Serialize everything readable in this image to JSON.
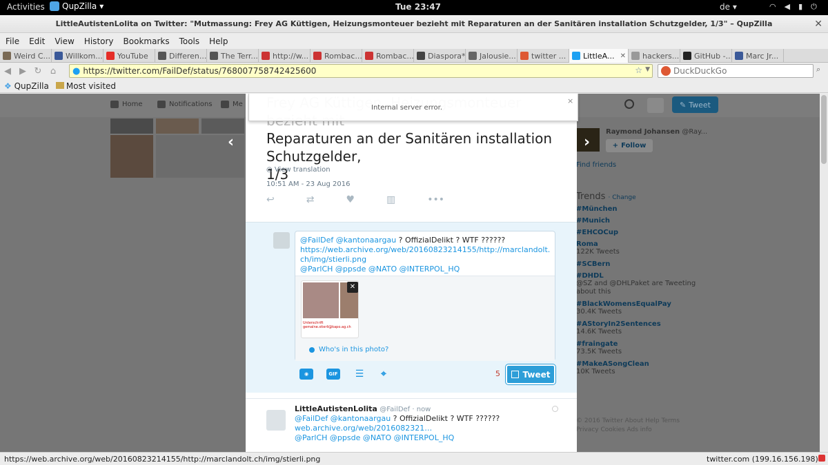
{
  "topbar": {
    "activities": "Activities",
    "app": "QupZilla",
    "clock": "Tue 23:47",
    "lang": "de"
  },
  "window": {
    "title": "LittleAutistenLolita on Twitter: \"Mutmassung: Frey AG Küttigen, Heizungsmonteuer bezieht mit Reparaturen an der Sanitären installation Schutzgelder, 1/3\" – QupZilla"
  },
  "menu": [
    "File",
    "Edit",
    "View",
    "History",
    "Bookmarks",
    "Tools",
    "Help"
  ],
  "tabs": [
    {
      "label": "Weird C...",
      "color": "#7a6a55"
    },
    {
      "label": "Willkom...",
      "color": "#3b5998"
    },
    {
      "label": "YouTube",
      "color": "#e52d27"
    },
    {
      "label": "Differen...",
      "color": "#555555"
    },
    {
      "label": "The Terr...",
      "color": "#555555"
    },
    {
      "label": "http://w...",
      "color": "#cc3333"
    },
    {
      "label": "Rombac...",
      "color": "#cc3333"
    },
    {
      "label": "Rombac...",
      "color": "#cc3333"
    },
    {
      "label": "Diaspora*",
      "color": "#444444"
    },
    {
      "label": "Jalousie...",
      "color": "#666666"
    },
    {
      "label": "twitter ...",
      "color": "#de5833"
    },
    {
      "label": "LittleA...",
      "color": "#1da1f2",
      "active": true
    },
    {
      "label": "hackers...",
      "color": "#999999"
    },
    {
      "label": "GitHub -...",
      "color": "#222222"
    },
    {
      "label": "Marc Jr...",
      "color": "#3b5998"
    }
  ],
  "nav": {
    "url": "https://twitter.com/FailDef/status/768007758742425600",
    "search_placeholder": "DuckDuckGo"
  },
  "bookmarks": {
    "qupzilla": "QupZilla",
    "most_visited": "Most visited"
  },
  "twitter_nav": {
    "home": "Home",
    "notifications": "Notifications",
    "messages": "Me",
    "tweet": "Tweet"
  },
  "error": {
    "message": "Internal server error.",
    "close": "×"
  },
  "tweet": {
    "ghost_line": "Frey AG Küttigen, Heizungsmonteuer bezieht mit",
    "line2": "Reparaturen an der Sanitären installation",
    "line3": "Schutzgelder,",
    "line4": "1/3",
    "translate": "View translation",
    "timestamp": "10:51 AM - 23 Aug 2016"
  },
  "composer": {
    "line1_mentions": "@FailDef @kantonaargau",
    "line1_text": " ? OffizialDelikt ? WTF ??????",
    "link": "https://web.archive.org/web/20160823214155/http://marclandolt.ch/img/stierli.png",
    "line3": "@ParlCH @ppsde @NATO @INTERPOL_HQ",
    "thumb_caption": "Unterschrift gemalne.stierli@kapo.ag.ch",
    "who": "Who's in this photo?",
    "gif": "GIF",
    "count": "5",
    "tweet_button": "Tweet"
  },
  "reply": {
    "name": "LittleAutistenLolita",
    "handle": "@FailDef · now",
    "line1_mentions": "@FailDef @kantonaargau",
    "line1_text": " ? OffizialDelikt ? WTF ??????",
    "link": "web.archive.org/web/2016082321…",
    "line3": "@ParlCH @ppsde @NATO @INTERPOL_HQ"
  },
  "sidebar": {
    "person": "Raymond Johansen",
    "handle": "@Ray...",
    "follow": "Follow",
    "find_friends": "Find friends",
    "trends_title": "Trends",
    "trends_change": "· Change",
    "trends": [
      {
        "tag": "#München",
        "sub": ""
      },
      {
        "tag": "#Munich",
        "sub": ""
      },
      {
        "tag": "#EHCOCup",
        "sub": ""
      },
      {
        "tag": "Roma",
        "sub": "122K Tweets"
      },
      {
        "tag": "#SCBern",
        "sub": ""
      },
      {
        "tag": "#DHDL",
        "sub": "@SZ and @DHLPaket are Tweeting about this"
      },
      {
        "tag": "#BlackWomensEqualPay",
        "sub": "30.4K Tweets"
      },
      {
        "tag": "#AStoryIn2Sentences",
        "sub": "14.6K Tweets"
      },
      {
        "tag": "#fraingate",
        "sub": "73.5K Tweets"
      },
      {
        "tag": "#MakeASongClean",
        "sub": "10K Tweets"
      }
    ],
    "footer1": "© 2016 Twitter   About   Help   Terms",
    "footer2": "Privacy   Cookies   Ads info"
  },
  "status": {
    "left": "https://web.archive.org/web/20160823214155/http://marclandolt.ch/img/stierli.png",
    "right": "twitter.com (199.16.156.198)"
  }
}
